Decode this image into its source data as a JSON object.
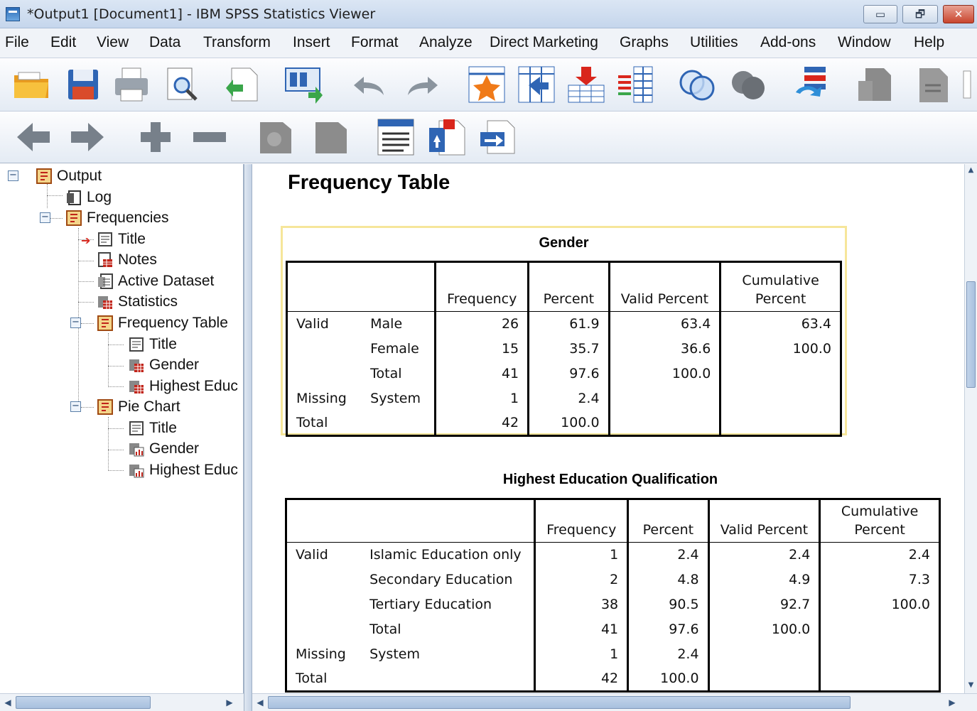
{
  "window": {
    "title": "*Output1 [Document1] - IBM SPSS Statistics Viewer",
    "buttons": {
      "minimize": "▭",
      "restore": "🗗",
      "close": "✕"
    }
  },
  "menu": [
    "File",
    "Edit",
    "View",
    "Data",
    "Transform",
    "Insert",
    "Format",
    "Analyze",
    "Direct Marketing",
    "Graphs",
    "Utilities",
    "Add-ons",
    "Window",
    "Help"
  ],
  "toolbar1": [
    "open-folder-icon",
    "save-icon",
    "print-icon",
    "print-preview-icon",
    "export-icon",
    "recall-dialog-icon",
    "undo-icon",
    "redo-icon",
    "goto-case-icon",
    "goto-variable-icon",
    "insert-cases-icon",
    "insert-variable-icon",
    "weight-cases-icon",
    "split-file-icon",
    "value-labels-icon",
    "designated-window-icon",
    "insert-output-icon"
  ],
  "toolbar2": [
    "back-icon",
    "forward-icon",
    "expand-icon",
    "collapse-icon",
    "show-icon",
    "hide-icon",
    "insert-heading-icon",
    "insert-title-icon",
    "insert-text-icon"
  ],
  "tree": {
    "items": [
      {
        "label": "Output",
        "icon": "output-book-icon"
      },
      {
        "label": "Log",
        "icon": "log-icon"
      },
      {
        "label": "Frequencies",
        "icon": "procedure-book-icon"
      },
      {
        "label": "Title",
        "icon": "title-icon"
      },
      {
        "label": "Notes",
        "icon": "notes-icon"
      },
      {
        "label": "Active Dataset",
        "icon": "dataset-icon"
      },
      {
        "label": "Statistics",
        "icon": "table-icon"
      },
      {
        "label": "Frequency Table",
        "icon": "procedure-book-icon"
      },
      {
        "label": "Title",
        "icon": "title-icon"
      },
      {
        "label": "Gender",
        "icon": "table-icon"
      },
      {
        "label": "Highest Educ",
        "icon": "table-icon"
      },
      {
        "label": "Pie Chart",
        "icon": "procedure-book-icon"
      },
      {
        "label": "Title",
        "icon": "title-icon"
      },
      {
        "label": "Gender",
        "icon": "chart-icon"
      },
      {
        "label": "Highest Educ",
        "icon": "chart-icon"
      }
    ]
  },
  "output": {
    "heading": "Frequency Table",
    "gender_table": {
      "title": "Gender",
      "headers": [
        "Frequency",
        "Percent",
        "Valid Percent",
        "Cumulative",
        "Percent"
      ],
      "rows": [
        [
          "Valid",
          "Male",
          "26",
          "61.9",
          "63.4",
          "63.4"
        ],
        [
          "",
          "Female",
          "15",
          "35.7",
          "36.6",
          "100.0"
        ],
        [
          "",
          "Total",
          "41",
          "97.6",
          "100.0",
          ""
        ],
        [
          "Missing",
          "System",
          "1",
          "2.4",
          "",
          ""
        ],
        [
          "Total",
          "",
          "42",
          "100.0",
          "",
          ""
        ]
      ]
    },
    "education_table": {
      "title": "Highest Education Qualification",
      "headers": [
        "Frequency",
        "Percent",
        "Valid Percent",
        "Cumulative",
        "Percent"
      ],
      "rows": [
        [
          "Valid",
          "Islamic Education only",
          "1",
          "2.4",
          "2.4",
          "2.4"
        ],
        [
          "",
          "Secondary Education",
          "2",
          "4.8",
          "4.9",
          "7.3"
        ],
        [
          "",
          "Tertiary Education",
          "38",
          "90.5",
          "92.7",
          "100.0"
        ],
        [
          "",
          "Total",
          "41",
          "97.6",
          "100.0",
          ""
        ],
        [
          "Missing",
          "System",
          "1",
          "2.4",
          "",
          ""
        ],
        [
          "Total",
          "",
          "42",
          "100.0",
          "",
          ""
        ]
      ]
    }
  },
  "colors": {
    "selection_border": "#f6e69a",
    "chrome": "#dbe6f4",
    "accent": "#2c6db8"
  }
}
